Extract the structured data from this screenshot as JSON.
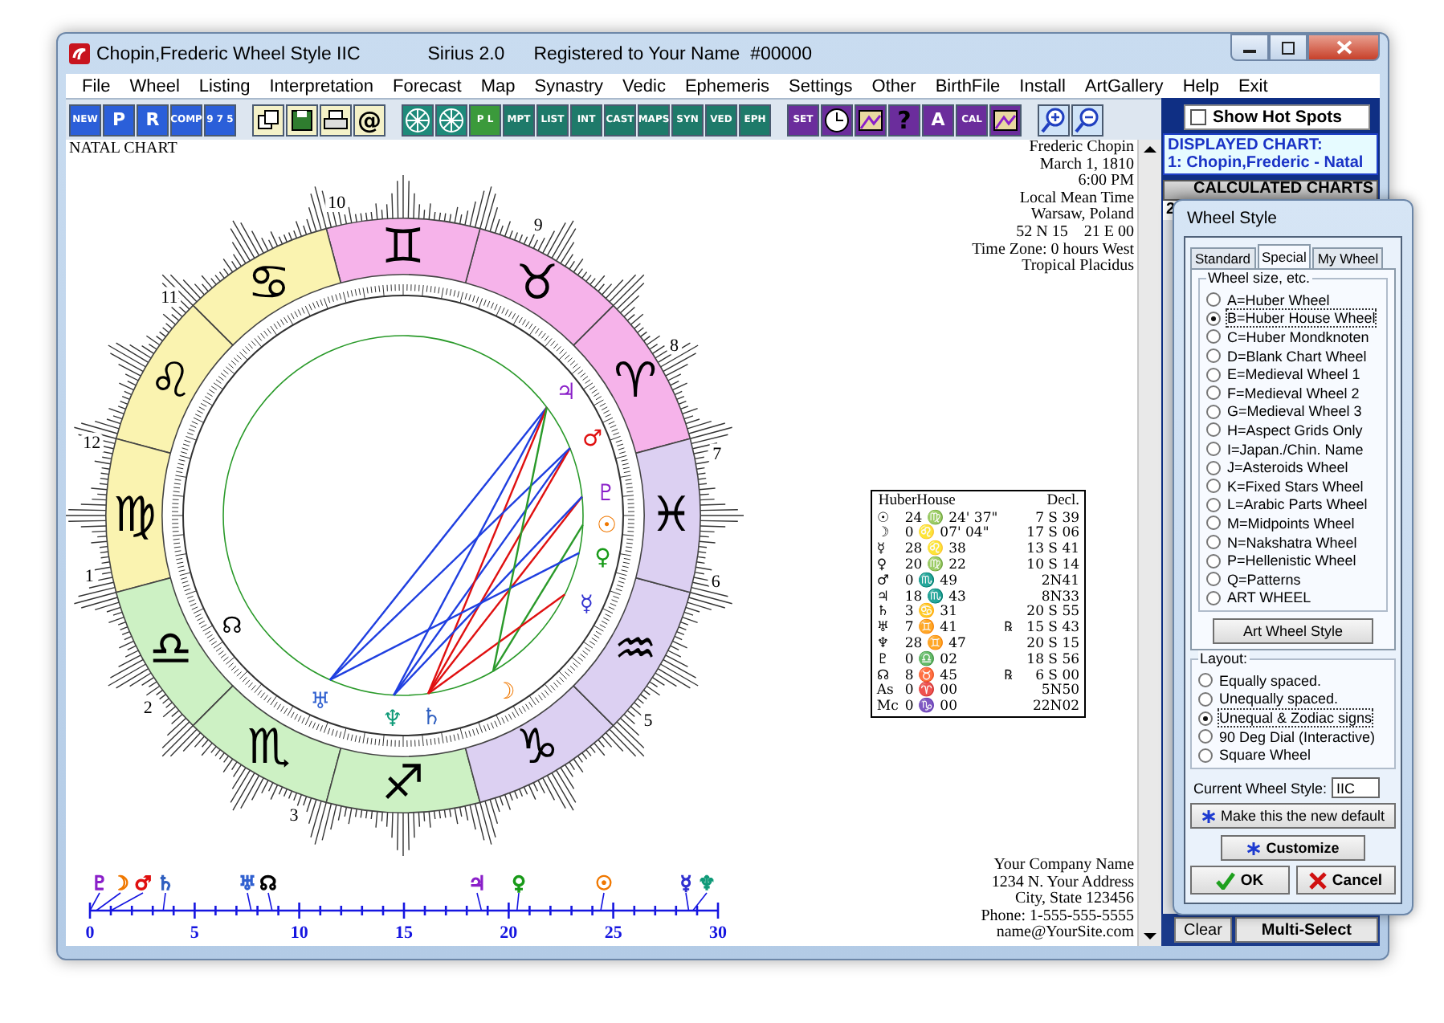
{
  "window": {
    "title": "Chopin,Frederic Wheel Style IIC",
    "app": "Sirius 2.0",
    "registration": "Registered to Your Name  #00000"
  },
  "menu": [
    {
      "label": "File"
    },
    {
      "label": "Wheel"
    },
    {
      "label": "Listing"
    },
    {
      "label": "Interpretation"
    },
    {
      "label": "Forecast"
    },
    {
      "label": "Map"
    },
    {
      "label": "Synastry"
    },
    {
      "label": "Vedic"
    },
    {
      "label": "Ephemeris"
    },
    {
      "label": "Settings"
    },
    {
      "label": "Other"
    },
    {
      "label": "BirthFile"
    },
    {
      "label": "Install"
    },
    {
      "label": "ArtGallery"
    },
    {
      "label": "Help"
    },
    {
      "label": "Exit"
    }
  ],
  "toolbar": [
    {
      "kind": "labeled",
      "label": "NEW",
      "color": "#2b5fd9"
    },
    {
      "kind": "labeled",
      "label": "P",
      "color": "#2b5fd9"
    },
    {
      "kind": "labeled",
      "label": "R",
      "color": "#2b5fd9"
    },
    {
      "kind": "labeled",
      "label": "COMP",
      "color": "#2b5fd9"
    },
    {
      "kind": "labeled",
      "label": "9 7 5",
      "color": "#2b5fd9"
    },
    {
      "kind": "windows",
      "color": "#f4f1c8"
    },
    {
      "kind": "disk",
      "color": "#f4f1c8"
    },
    {
      "kind": "printer",
      "color": "#f4f1c8"
    },
    {
      "kind": "glyph",
      "label": "@",
      "color": "#f4f1c8"
    },
    {
      "kind": "wheel",
      "color": "#1e8a7a"
    },
    {
      "kind": "wheel",
      "color": "#1e8a7a"
    },
    {
      "kind": "labeled",
      "label": "P L",
      "color": "#3b9a3b"
    },
    {
      "kind": "labeled",
      "label": "MPT",
      "color": "#1e7a6a"
    },
    {
      "kind": "labeled",
      "label": "LIST",
      "color": "#1e7a6a"
    },
    {
      "kind": "labeled",
      "label": "INT",
      "color": "#1e7a6a"
    },
    {
      "kind": "labeled",
      "label": "CAST",
      "color": "#1e7a6a"
    },
    {
      "kind": "labeled",
      "label": "MAPS",
      "color": "#1e7a6a"
    },
    {
      "kind": "labeled",
      "label": "SYN",
      "color": "#1e7a6a"
    },
    {
      "kind": "labeled",
      "label": "VED",
      "color": "#1e7a6a"
    },
    {
      "kind": "labeled",
      "label": "EPH",
      "color": "#1e7a6a"
    },
    {
      "kind": "labeled",
      "label": "SET",
      "color": "#6b2d9c"
    },
    {
      "kind": "clock",
      "color": "#6b2d9c"
    },
    {
      "kind": "picture",
      "color": "#6b2d9c"
    },
    {
      "kind": "glyph",
      "label": "?",
      "color": "#6b2d9c"
    },
    {
      "kind": "labeled",
      "label": "A",
      "color": "#6b2d9c"
    },
    {
      "kind": "labeled",
      "label": "CAL",
      "color": "#6b2d9c"
    },
    {
      "kind": "picture",
      "color": "#6b2d9c"
    },
    {
      "kind": "zoom-in",
      "color": "#cfe3f7"
    },
    {
      "kind": "zoom-out",
      "color": "#cfe3f7"
    }
  ],
  "hot_spots": {
    "label": "Show Hot Spots",
    "checked": false
  },
  "displayed_chart": {
    "title": "DISPLAYED CHART:",
    "name": "1: Chopin,Frederic - Natal"
  },
  "calculated_charts": {
    "title": "CALCULATED CHARTS",
    "number": "2"
  },
  "panel_buttons": [
    {
      "label": "Clear"
    },
    {
      "label": "Multi-Select"
    }
  ],
  "chart": {
    "title": "NATAL CHART",
    "info": [
      "Frederic Chopin",
      "March 1, 1810",
      "6:00 PM",
      "Local Mean Time",
      "Warsaw, Poland",
      "52 N 15    21 E 00",
      "Time Zone: 0 hours West",
      "Tropical Placidus"
    ],
    "signs": [
      {
        "symbol": "♈",
        "color": "#f6b3ea"
      },
      {
        "symbol": "♉",
        "color": "#f6b3ea"
      },
      {
        "symbol": "♊",
        "color": "#f6b3ea"
      },
      {
        "symbol": "♋",
        "color": "#faf3b0"
      },
      {
        "symbol": "♌",
        "color": "#faf3b0"
      },
      {
        "symbol": "♍",
        "color": "#faf3b0"
      },
      {
        "symbol": "♎",
        "color": "#cdf1c4"
      },
      {
        "symbol": "♏",
        "color": "#cdf1c4"
      },
      {
        "symbol": "♐",
        "color": "#cdf1c4"
      },
      {
        "symbol": "♑",
        "color": "#dcd0f2"
      },
      {
        "symbol": "♒",
        "color": "#dcd0f2"
      },
      {
        "symbol": "♓",
        "color": "#dcd0f2"
      }
    ],
    "houses": [
      "10",
      "11",
      "12",
      "1",
      "2",
      "3",
      "5",
      "6",
      "7",
      "8",
      "9"
    ],
    "planets": [
      {
        "symbol": "♃",
        "color": "#8a1fc9"
      },
      {
        "symbol": "♂",
        "color": "#e01010"
      },
      {
        "symbol": "♇",
        "color": "#8a1fc9"
      },
      {
        "symbol": "☉",
        "color": "#f07800"
      },
      {
        "symbol": "♀",
        "color": "#189a18"
      },
      {
        "symbol": "☿",
        "color": "#3030d0"
      },
      {
        "symbol": "☽",
        "color": "#f07800"
      },
      {
        "symbol": "♄",
        "color": "#3060c0"
      },
      {
        "symbol": "♆",
        "color": "#0f9a78"
      },
      {
        "symbol": "♅",
        "color": "#3060d0"
      },
      {
        "symbol": "☊",
        "color": "#000000"
      }
    ],
    "table": {
      "columns": [
        "HuberHouse",
        "Decl."
      ],
      "rows": [
        {
          "planet": "☉",
          "position": "24 ♍ 24' 37\"",
          "declination": "7 S 39"
        },
        {
          "planet": "☽",
          "position": "0 ♌ 07' 04\"",
          "declination": "17 S 06"
        },
        {
          "planet": "☿",
          "position": "28 ♌ 38",
          "declination": "13 S 41"
        },
        {
          "planet": "♀",
          "position": "20 ♍ 22",
          "declination": "10 S 14"
        },
        {
          "planet": "♂",
          "position": "0 ♏ 49",
          "declination": "2N41"
        },
        {
          "planet": "♃",
          "position": "18 ♏ 43",
          "declination": "8N33"
        },
        {
          "planet": "♄",
          "position": "3 ♋ 31",
          "declination": "20 S 55"
        },
        {
          "planet": "♅",
          "position": "7 ♊ 41",
          "motion": "℞",
          "declination": "15 S 43"
        },
        {
          "planet": "♆",
          "position": "28 ♊ 47",
          "declination": "20 S 15"
        },
        {
          "planet": "♇",
          "position": "0 ♎ 02",
          "declination": "18 S 56"
        },
        {
          "planet": "☊",
          "position": "8 ♉ 45",
          "motion": "℞",
          "declination": "6 S 00"
        },
        {
          "planet": "As",
          "position": "0 ♈ 00",
          "declination": "5N50"
        },
        {
          "planet": "Mc",
          "position": "0 ♑ 00",
          "declination": "22N02"
        }
      ]
    },
    "dial": {
      "ticks": [
        "0",
        "5",
        "10",
        "15",
        "20",
        "25",
        "30"
      ],
      "planets": [
        {
          "symbol": "♇",
          "color": "#8a1fc9"
        },
        {
          "symbol": "☽",
          "color": "#f07800"
        },
        {
          "symbol": "♂",
          "color": "#e01010"
        },
        {
          "symbol": "♄",
          "color": "#3060c0"
        },
        {
          "symbol": "♅",
          "color": "#3060d0"
        },
        {
          "symbol": "☊",
          "color": "#000000"
        },
        {
          "symbol": "♃",
          "color": "#8a1fc9"
        },
        {
          "symbol": "♀",
          "color": "#189a18"
        },
        {
          "symbol": "☉",
          "color": "#f07800"
        },
        {
          "symbol": "☿",
          "color": "#3030d0"
        },
        {
          "symbol": "♆",
          "color": "#0f9a78"
        }
      ]
    },
    "footer": [
      "Your Company Name",
      "1234 N. Your Address",
      "City, State 123456",
      "Phone: 1-555-555-5555",
      "name@YourSite.com"
    ]
  },
  "dialog": {
    "title": "Wheel Style",
    "tabs": [
      {
        "label": "Standard",
        "selected": false
      },
      {
        "label": "Special",
        "selected": true
      },
      {
        "label": "My Wheel",
        "selected": false
      }
    ],
    "wheel_group": {
      "title": "Wheel size, etc.",
      "options": [
        {
          "label": "A=Huber Wheel",
          "selected": false
        },
        {
          "label": "B=Huber House Wheel",
          "selected": true
        },
        {
          "label": "C=Huber Mondknoten",
          "selected": false
        },
        {
          "label": "D=Blank Chart Wheel",
          "selected": false
        },
        {
          "label": "E=Medieval Wheel 1",
          "selected": false
        },
        {
          "label": "F=Medieval Wheel 2",
          "selected": false
        },
        {
          "label": "G=Medieval Wheel 3",
          "selected": false
        },
        {
          "label": "H=Aspect Grids Only",
          "selected": false
        },
        {
          "label": "I=Japan./Chin. Name",
          "selected": false
        },
        {
          "label": "J=Asteroids Wheel",
          "selected": false
        },
        {
          "label": "K=Fixed Stars Wheel",
          "selected": false
        },
        {
          "label": "L=Arabic Parts Wheel",
          "selected": false
        },
        {
          "label": "M=Midpoints Wheel",
          "selected": false
        },
        {
          "label": "N=Nakshatra Wheel",
          "selected": false
        },
        {
          "label": "P=Hellenistic Wheel",
          "selected": false
        },
        {
          "label": "Q=Patterns",
          "selected": false
        },
        {
          "label": "ART WHEEL",
          "selected": false
        }
      ]
    },
    "art_button": "Art Wheel Style",
    "layout_group": {
      "title": "Layout:",
      "options": [
        {
          "label": "Equally spaced.",
          "selected": false
        },
        {
          "label": "Unequally spaced.",
          "selected": false
        },
        {
          "label": "Unequal & Zodiac signs",
          "selected": true
        },
        {
          "label": "90 Deg Dial (Interactive)",
          "selected": false
        },
        {
          "label": "Square Wheel",
          "selected": false
        }
      ]
    },
    "current_style": {
      "label": "Current Wheel Style:",
      "value": "IIC"
    },
    "default_button": "Make this the new default",
    "customize_button": "Customize",
    "ok_button": "OK",
    "cancel_button": "Cancel"
  }
}
